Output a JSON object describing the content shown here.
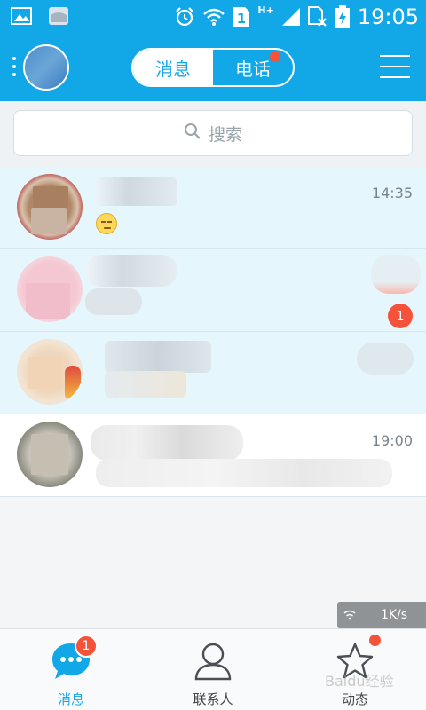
{
  "status_bar": {
    "network": "H+",
    "sim": "1",
    "time": "19:05"
  },
  "header": {
    "tabs": [
      {
        "label": "消息",
        "active": true
      },
      {
        "label": "电话",
        "active": false,
        "has_dot": true
      }
    ]
  },
  "search": {
    "placeholder": "搜索"
  },
  "conversations": [
    {
      "name": "",
      "preview_emoji": "unamused-emoji",
      "time": "14:35",
      "unread": null,
      "pinned": true
    },
    {
      "name": "",
      "preview": "",
      "time": "",
      "unread": "1",
      "pinned": true
    },
    {
      "name": "",
      "preview": "",
      "time": "",
      "unread": null,
      "pinned": true
    },
    {
      "name": "",
      "preview": "",
      "time": "19:00",
      "unread": null,
      "pinned": false
    }
  ],
  "net_speed": "1K/s",
  "bottom_nav": [
    {
      "label": "消息",
      "active": true,
      "badge": "1"
    },
    {
      "label": "联系人",
      "active": false
    },
    {
      "label": "动态",
      "active": false,
      "has_dot": true
    }
  ],
  "watermark": "Baidu经验",
  "colors": {
    "brand": "#12a8e8",
    "badge": "#f5523b"
  }
}
